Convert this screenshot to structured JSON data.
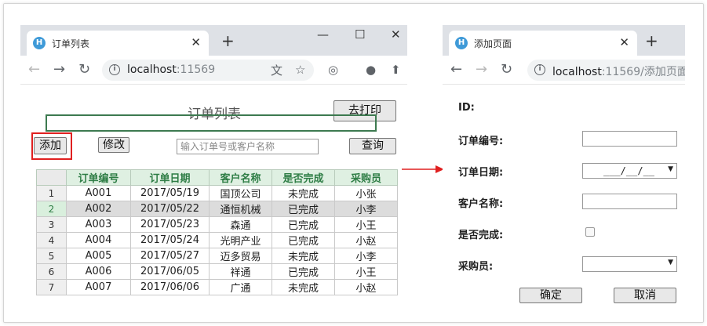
{
  "orders_window": {
    "tab_title": "订单列表",
    "url_host": "localhost",
    "url_rest": ":11569",
    "page_title": "订单列表",
    "print_label": "去打印",
    "add_label": "添加",
    "edit_label": "修改",
    "search_placeholder": "输入订单号或客户名称",
    "query_label": "查询",
    "columns": [
      "订单编号",
      "订单日期",
      "客户名称",
      "是否完成",
      "采购员"
    ],
    "rows": [
      {
        "num": "1",
        "id": "A001",
        "date": "2017/05/19",
        "customer": "国顶公司",
        "done": "未完成",
        "buyer": "小张"
      },
      {
        "num": "2",
        "id": "A002",
        "date": "2017/05/22",
        "customer": "通恒机械",
        "done": "已完成",
        "buyer": "小李"
      },
      {
        "num": "3",
        "id": "A003",
        "date": "2017/05/23",
        "customer": "森通",
        "done": "已完成",
        "buyer": "小王"
      },
      {
        "num": "4",
        "id": "A004",
        "date": "2017/05/24",
        "customer": "光明产业",
        "done": "已完成",
        "buyer": "小赵"
      },
      {
        "num": "5",
        "id": "A005",
        "date": "2017/05/27",
        "customer": "迈多贸易",
        "done": "未完成",
        "buyer": "小李"
      },
      {
        "num": "6",
        "id": "A006",
        "date": "2017/06/05",
        "customer": "祥通",
        "done": "已完成",
        "buyer": "小王"
      },
      {
        "num": "7",
        "id": "A007",
        "date": "2017/06/06",
        "customer": "广通",
        "done": "未完成",
        "buyer": "小赵"
      }
    ]
  },
  "add_window": {
    "tab_title": "添加页面",
    "url_host": "localhost",
    "url_rest": ":11569/添加页面",
    "id_label": "ID:",
    "order_no_label": "订单编号:",
    "order_date_label": "订单日期:",
    "date_value": "___/__/__",
    "customer_label": "客户名称:",
    "done_label": "是否完成:",
    "buyer_label": "采购员:",
    "confirm_label": "确定",
    "cancel_label": "取消"
  },
  "browser": {
    "favicon_letter": "H",
    "close_glyph": "✕",
    "new_tab_glyph": "+",
    "minimize_glyph": "—",
    "maximize_glyph": "☐",
    "window_close_glyph": "✕",
    "back_glyph": "←",
    "forward_glyph": "→",
    "reload_glyph": "↻",
    "info_glyph": "i",
    "translate_glyph": "文",
    "bookmark_glyph": "☆",
    "extension_glyph": "◎",
    "profile_glyph": "●",
    "update_glyph": "⬆"
  },
  "colors": {
    "highlight_red": "#e02020",
    "header_green": "#2e7d45",
    "chrome_tab_strip": "#dee1e6"
  }
}
